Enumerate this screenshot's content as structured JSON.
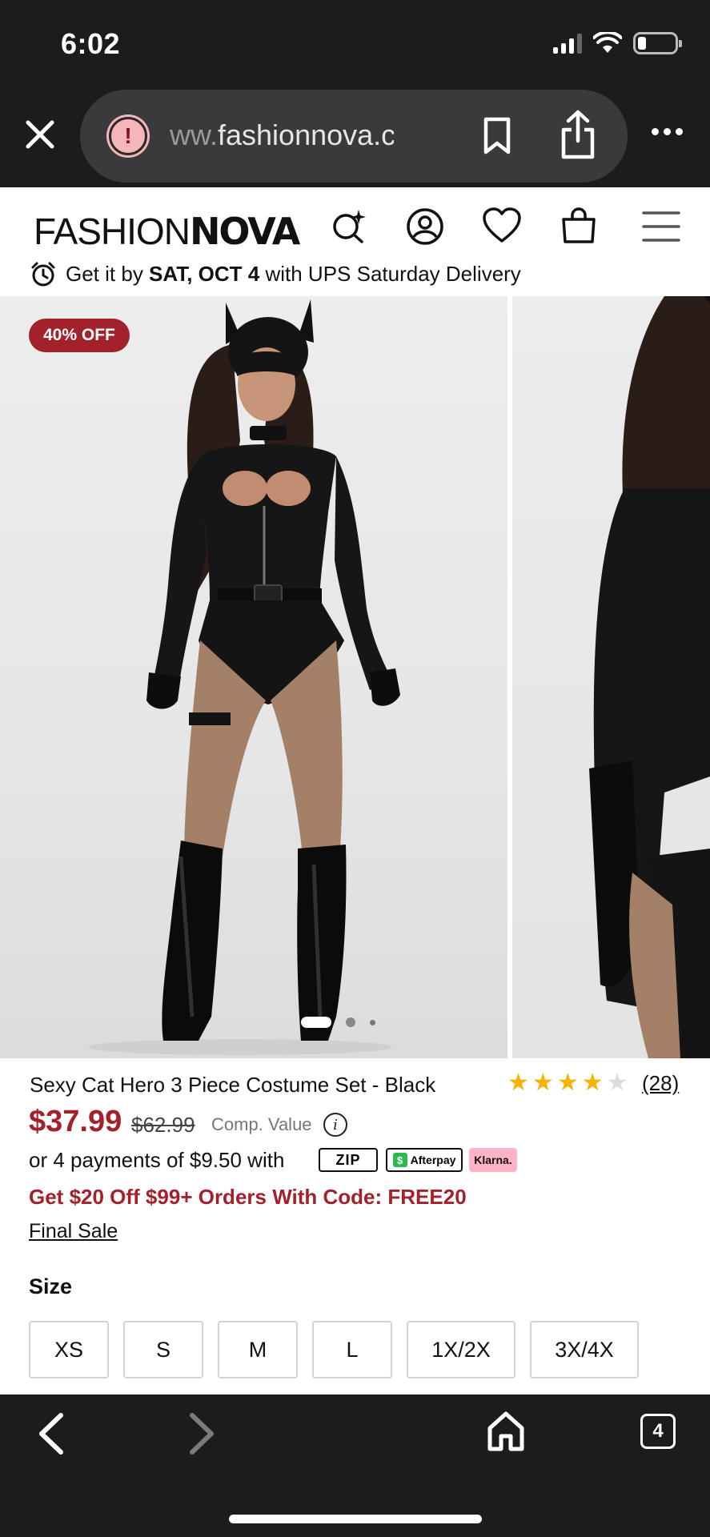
{
  "status_bar": {
    "time": "6:02",
    "battery_level": 0.22
  },
  "browser": {
    "url_faded": "ww.",
    "url_main": "fashionnova.com",
    "tab_count": "4"
  },
  "site": {
    "logo_thin": "FASHION",
    "logo_bold": "NOVA",
    "delivery_prefix": "Get it by ",
    "delivery_date": "SAT, OCT 4",
    "delivery_suffix": " with UPS Saturday Delivery"
  },
  "gallery": {
    "badge": "40% OFF",
    "slides": 3,
    "active_slide": 1
  },
  "product": {
    "title": "Sexy Cat Hero 3 Piece Costume Set - Black",
    "rating": 4,
    "rating_max": 5,
    "review_count": "(28)",
    "price": "$37.99",
    "old_price": "$62.99",
    "comp_value": "Comp. Value",
    "installments": "or 4 payments of $9.50 with",
    "pay_zip": "ZIP",
    "pay_afterpay": "Afterpay",
    "pay_klarna": "Klarna.",
    "promo": "Get $20 Off $99+ Orders With Code: FREE20",
    "final_sale": "Final Sale",
    "size_label": "Size",
    "sizes": [
      "XS",
      "S",
      "M",
      "L",
      "1X/2X",
      "3X/4X"
    ]
  },
  "colors": {
    "accent": "#a3212b",
    "star": "#f5b400",
    "star_empty": "#dcdcdc"
  }
}
